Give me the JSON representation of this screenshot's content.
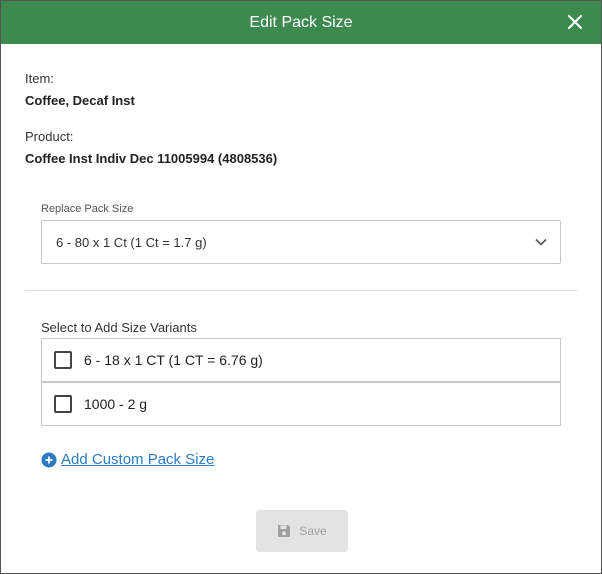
{
  "header": {
    "title": "Edit Pack Size",
    "close_icon": "close-icon",
    "color": "#3c8a4f"
  },
  "item": {
    "label": "Item:",
    "value": "Coffee, Decaf Inst"
  },
  "product": {
    "label": "Product:",
    "value": "Coffee Inst Indiv Dec 11005994 (4808536)"
  },
  "replace": {
    "label": "Replace Pack Size",
    "selected": "6 - 80 x 1 Ct (1 Ct = 1.7 g)",
    "icon": "chevron-down-icon"
  },
  "variants": {
    "label": "Select to Add Size Variants",
    "items": [
      {
        "label": "6 - 18 x 1 CT (1 CT = 6.76 g)",
        "checked": false
      },
      {
        "label": "1000 - 2 g",
        "checked": false
      }
    ]
  },
  "add_custom": {
    "label": "Add Custom Pack Size",
    "icon": "plus-circle-icon",
    "color": "#2a7bbf"
  },
  "save": {
    "label": "Save",
    "icon": "save-icon",
    "disabled": true
  }
}
